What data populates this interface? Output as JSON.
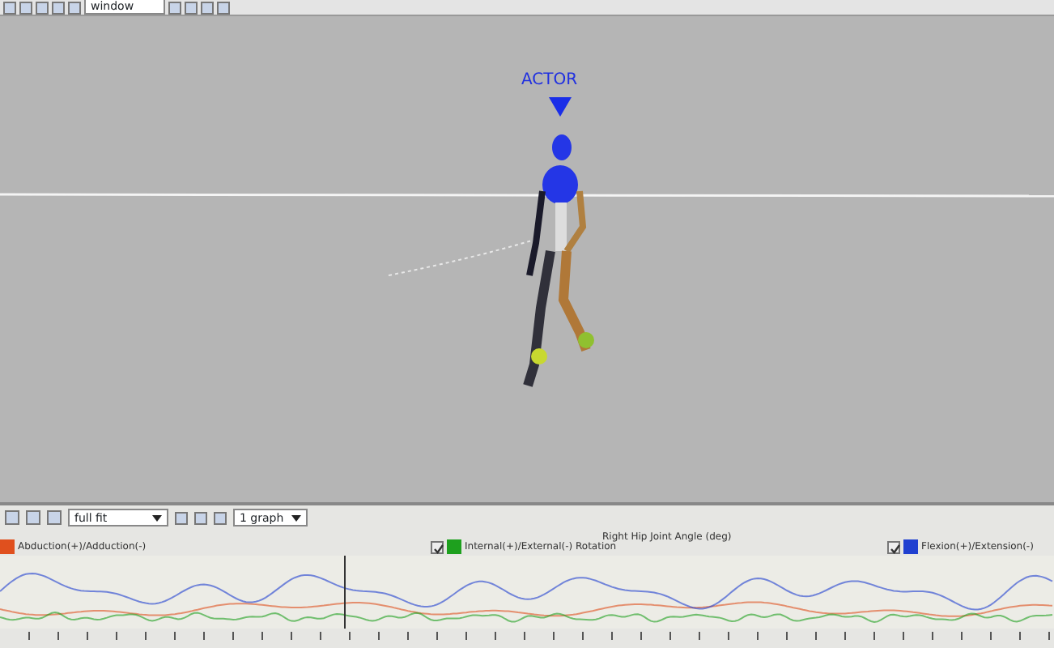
{
  "toolbar": {
    "view_dropdown": "window"
  },
  "viewport": {
    "actor_label": "ACTOR"
  },
  "graph_toolbar": {
    "fit_dropdown": "full fit",
    "graph_count_dropdown": "1 graph"
  },
  "graph": {
    "title": "Right Hip Joint Angle (deg)",
    "series": [
      {
        "name": "Abduction(+)/Adduction(-)",
        "color": "#e0501e"
      },
      {
        "name": "Internal(+)/External(-) Rotation",
        "color": "#1ea01e",
        "checked": true
      },
      {
        "name": "Flexion(+)/Extension(-)",
        "color": "#2040d0",
        "checked": true
      }
    ]
  }
}
